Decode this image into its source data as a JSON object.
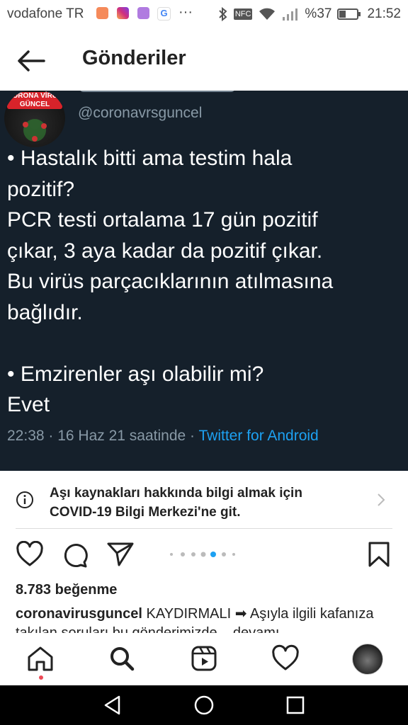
{
  "status_bar": {
    "carrier": "vodafone TR",
    "dots": "···",
    "nfc": "NFC",
    "battery": "%37",
    "time": "21:52"
  },
  "header": {
    "title": "Gönderiler"
  },
  "tweet": {
    "avatar_badge": "CORONA VİRÜS GÜNCEL",
    "handle": "@coronavrsguncel",
    "body": "• Hastalık bitti ama testim hala\npozitif?\nPCR testi ortalama 17 gün pozitif\nçıkar, 3 aya kadar da pozitif çıkar.\nBu virüs parçacıklarının atılmasına\nbağlıdır.\n\n• Emzirenler aşı olabilir mi?\nEvet",
    "time": "22:38",
    "date": "16 Haz 21 saatinde",
    "source": "Twitter for Android"
  },
  "covid_banner": {
    "line1": "Aşı kaynakları hakkında bilgi almak için",
    "line2": "COVID-19 Bilgi Merkezi'ne git."
  },
  "post": {
    "likes": "8.783 beğenme",
    "caption_user": "coronavirusguncel",
    "caption_text": " KAYDIRMALI ➡ Aşıyla ilgili kafanıza takılan soruları bu gönderimizde... devamı"
  },
  "colors": {
    "tweet_bg": "#15202b",
    "tweet_muted": "#8899a6",
    "link": "#1da1f2",
    "active_dot": "#1da1f2",
    "notification": "#ed4956"
  }
}
